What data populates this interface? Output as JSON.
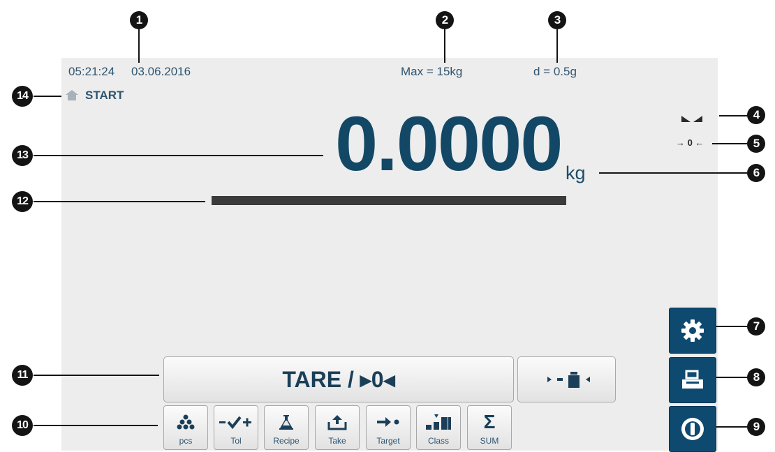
{
  "header": {
    "time": "05:21:24",
    "date": "03.06.2016",
    "max": "Max = 15kg",
    "d": "d = 0.5g"
  },
  "breadcrumb": {
    "label": "START"
  },
  "weight": {
    "value": "0.0000",
    "unit": "kg"
  },
  "zero_indicator": "→ 0 ←",
  "callouts": [
    "1",
    "2",
    "3",
    "4",
    "5",
    "6",
    "7",
    "8",
    "9",
    "10",
    "11",
    "12",
    "13",
    "14"
  ],
  "tare_button": {
    "label": "TARE / ▸0◂"
  },
  "function_buttons": [
    {
      "icon": "pieces-icon",
      "label": "pcs"
    },
    {
      "icon": "tolerance-icon",
      "label": "Tol"
    },
    {
      "icon": "recipe-flask-icon",
      "label": "Recipe"
    },
    {
      "icon": "take-upload-icon",
      "label": "Take"
    },
    {
      "icon": "target-icon",
      "label": "Target"
    },
    {
      "icon": "class-icon",
      "label": "Class"
    },
    {
      "icon": "sum-icon",
      "label": "SUM"
    }
  ],
  "side_buttons": [
    {
      "icon": "gear-icon"
    },
    {
      "icon": "printer-icon"
    },
    {
      "icon": "power-icon"
    }
  ],
  "colors": {
    "accent": "#0e4a70",
    "text": "#2f5570",
    "weight": "#124866"
  }
}
